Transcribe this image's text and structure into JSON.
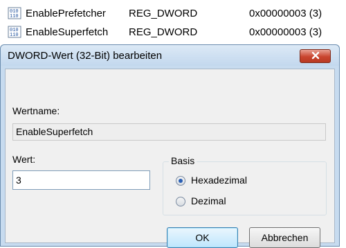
{
  "registry": {
    "rows": [
      {
        "icon": "dword-value-icon",
        "name": "EnablePrefetcher",
        "type": "REG_DWORD",
        "data": "0x00000003 (3)"
      },
      {
        "icon": "dword-value-icon",
        "name": "EnableSuperfetch",
        "type": "REG_DWORD",
        "data": "0x00000003 (3)"
      }
    ]
  },
  "dialog": {
    "title": "DWORD-Wert (32-Bit) bearbeiten",
    "close_icon": "close-icon",
    "value_name_label": "Wertname:",
    "value_name": "EnableSuperfetch",
    "value_label": "Wert:",
    "value": "3",
    "base": {
      "title": "Basis",
      "options": [
        {
          "label": "Hexadezimal",
          "selected": true
        },
        {
          "label": "Dezimal",
          "selected": false
        }
      ]
    },
    "ok_label": "OK",
    "cancel_label": "Abbrechen"
  },
  "colors": {
    "dialog_frame": "#c7dbef",
    "client_bg": "#f0f0f0",
    "close_button": "#c9452f"
  }
}
